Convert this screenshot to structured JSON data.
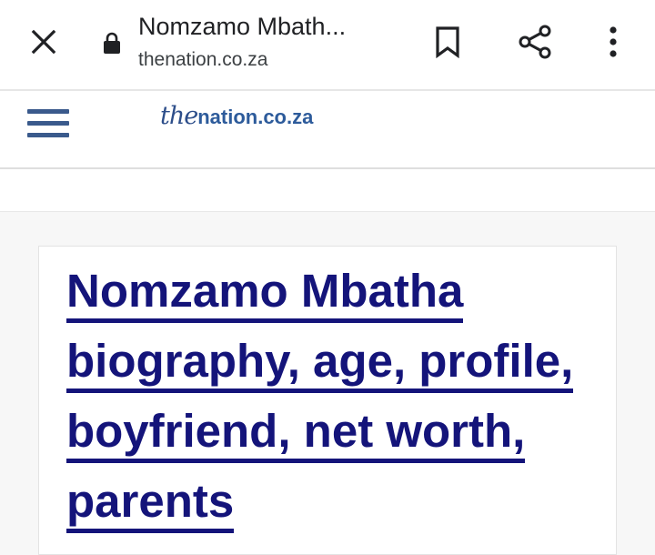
{
  "browser": {
    "page_title": "Nomzamo Mbath...",
    "domain": "thenation.co.za",
    "icons": {
      "close": "close-icon",
      "lock": "lock-icon",
      "bookmark": "bookmark-icon",
      "share": "share-icon",
      "more": "more-vert-icon"
    }
  },
  "site": {
    "logo_prefix": "the",
    "logo_suffix": "nation.co.za",
    "menu_icon": "hamburger-menu-icon",
    "colors": {
      "logo": "#2d5b9b",
      "headline": "#14147a"
    }
  },
  "article": {
    "headline": "Nomzamo Mbatha biography, age, profile, boyfriend, net worth, parents"
  }
}
